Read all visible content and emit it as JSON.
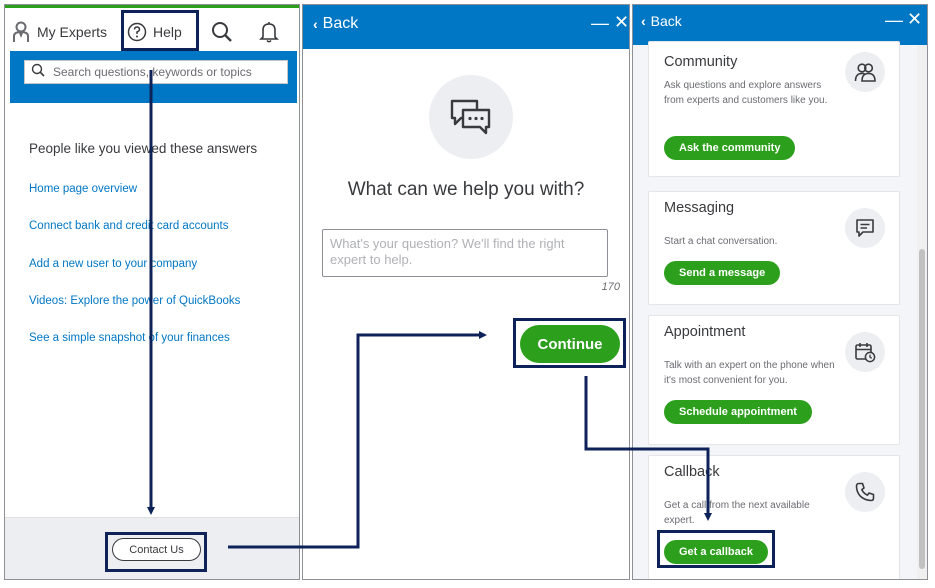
{
  "panel1": {
    "nav": {
      "experts_label": "My Experts",
      "help_label": "Help",
      "search_icon": "search-icon",
      "bell_icon": "bell-icon"
    },
    "search": {
      "placeholder": "Search questions, keywords or topics"
    },
    "heading": "People like you viewed these answers",
    "links": [
      "Home page overview",
      "Connect bank and credit card accounts",
      "Add a new user to your company",
      "Videos: Explore the power of QuickBooks",
      "See a simple snapshot of your finances"
    ],
    "contact_label": "Contact Us"
  },
  "panel2": {
    "back_label": "Back",
    "title": "What can we help you with?",
    "question_placeholder": "What's your question? We'll find the right expert to help.",
    "char_count": "170",
    "continue_label": "Continue"
  },
  "panel3": {
    "back_label": "Back",
    "cards": [
      {
        "title": "Community",
        "desc": "Ask questions and explore answers from experts and customers like you.",
        "button": "Ask the community",
        "icon": "people-icon"
      },
      {
        "title": "Messaging",
        "desc": "Start a chat conversation.",
        "button": "Send a message",
        "icon": "chat-icon"
      },
      {
        "title": "Appointment",
        "desc": "Talk with an expert on the phone when it's most convenient for you.",
        "button": "Schedule appointment",
        "icon": "calendar-icon"
      },
      {
        "title": "Callback",
        "desc": "Get a call from the next available expert.",
        "button": "Get a callback",
        "icon": "phone-icon"
      }
    ]
  },
  "colors": {
    "brand_blue": "#0077c5",
    "brand_green": "#2ca01c",
    "annotation_navy": "#0d2259"
  }
}
